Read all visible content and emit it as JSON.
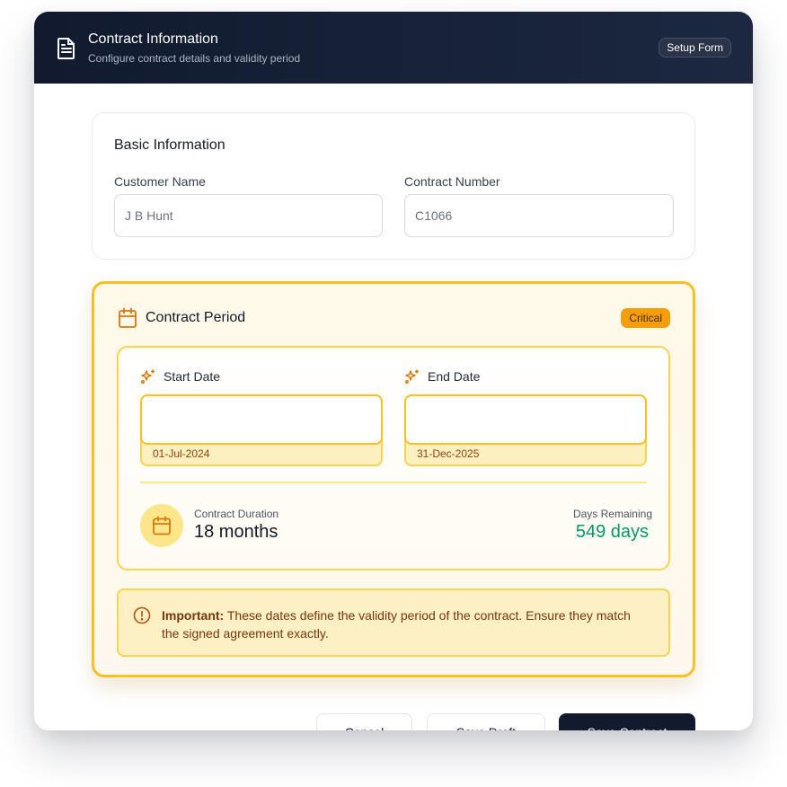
{
  "header": {
    "title": "Contract Information",
    "subtitle": "Configure contract details and validity period",
    "badge": "Setup Form",
    "icon": "document-icon"
  },
  "basic_info": {
    "title": "Basic Information",
    "customer_name": {
      "label": "Customer Name",
      "placeholder": "J B Hunt",
      "value": ""
    },
    "contract_number": {
      "label": "Contract Number",
      "placeholder": "C1066",
      "value": ""
    }
  },
  "contract_period": {
    "title": "Contract Period",
    "badge": "Critical",
    "start_date": {
      "label": "Start Date",
      "display": "01-Jul-2024"
    },
    "end_date": {
      "label": "End Date",
      "display": "31-Dec-2025"
    },
    "duration": {
      "label": "Contract Duration",
      "value": "18 months"
    },
    "remaining": {
      "label": "Days Remaining",
      "value": "549 days"
    },
    "notice": {
      "strong": "Important:",
      "text": " These dates define the validity period of the contract. Ensure they match the signed agreement exactly."
    }
  },
  "actions": {
    "cancel": "Cancel",
    "save_draft": "Save Draft",
    "save_contract": "Save Contract"
  },
  "colors": {
    "header_bg": "#111a2e",
    "accent_amber": "#fbbf24",
    "critical_badge": "#f59e0b",
    "days_remaining": "#059669"
  }
}
